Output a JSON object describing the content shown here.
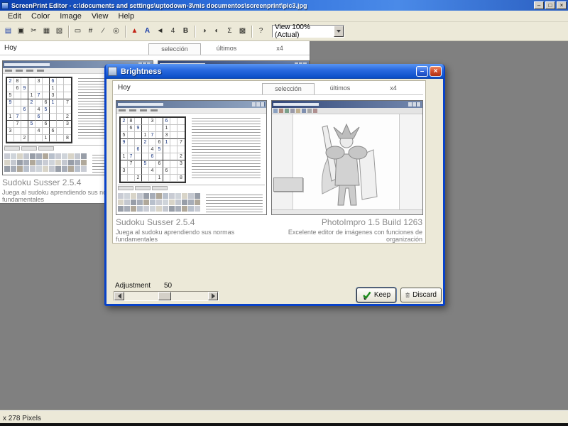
{
  "colors": {
    "titlebar_blue": "#2a6ad8",
    "desktop_gray": "#808080",
    "chrome_beige": "#ece9d8",
    "dialog_frame_blue": "#0842c8",
    "close_red": "#d4512e",
    "caption_gray": "#8a8a8a"
  },
  "window": {
    "title": "ScreenPrint Editor - c:\\documents and settings\\uptodown-3\\mis documentos\\screenprint\\pic3.jpg",
    "buttons": [
      {
        "name": "minimize",
        "glyph": "–"
      },
      {
        "name": "restore",
        "glyph": "□"
      },
      {
        "name": "close",
        "glyph": "×"
      }
    ],
    "menu": [
      "Edit",
      "Color",
      "Image",
      "View",
      "Help"
    ],
    "zoom_value": "View 100% (Actual)"
  },
  "toolbar": {
    "icons": [
      {
        "name": "save-icon",
        "glyph": "▤"
      },
      {
        "name": "capture-icon",
        "glyph": "▣"
      },
      {
        "name": "cut-icon",
        "glyph": "✂"
      },
      {
        "name": "copy-icon",
        "glyph": "▦"
      },
      {
        "name": "paste-icon",
        "glyph": "▧"
      },
      {
        "name": "select-icon",
        "glyph": "▭"
      },
      {
        "name": "crop-icon",
        "glyph": "#"
      },
      {
        "name": "pencil-icon",
        "glyph": "∕"
      },
      {
        "name": "zoom-icon",
        "glyph": "◎"
      },
      {
        "name": "warning-icon",
        "glyph": "▲"
      },
      {
        "name": "text-icon",
        "glyph": "A"
      },
      {
        "name": "mirror-icon",
        "glyph": "◄"
      },
      {
        "name": "rotate-icon",
        "glyph": "4"
      },
      {
        "name": "bold-icon",
        "glyph": "B"
      },
      {
        "name": "contrast-icon",
        "glyph": "◑"
      },
      {
        "name": "invert-icon",
        "glyph": "◐"
      },
      {
        "name": "sum-icon",
        "glyph": "Σ"
      },
      {
        "name": "gradient-icon",
        "glyph": "▩"
      },
      {
        "name": "help-icon",
        "glyph": "?"
      }
    ]
  },
  "page": {
    "header": "Hoy",
    "tabs": [
      "selección",
      "últimos",
      "x4"
    ],
    "left_app": {
      "title": "Sudoku Susser 2.5.4",
      "desc1": "Juega al sudoku aprendiendo sus normas",
      "desc2": "fundamentales"
    },
    "right_app": {
      "title": "PhotoImpro 1.5 Build 1263",
      "desc1": "Excelente editor de imágenes con funciones de",
      "desc2": "organización"
    },
    "sudoku_rows": [
      "28..3.6..",
      ".69...1..",
      "5..17.3..",
      "9..2.61.7",
      "..6.45...",
      "17..6...2",
      ".7.5.6..3",
      "3...4.6..",
      "..2..1..8"
    ]
  },
  "dialog": {
    "title": "Brightness",
    "buttons": [
      {
        "name": "minimize",
        "glyph": "–"
      },
      {
        "name": "close",
        "glyph": "×"
      }
    ],
    "adjustment": {
      "label": "Adjustment",
      "value": "50"
    },
    "keep_label": "Keep",
    "discard_label": "Discard"
  },
  "statusbar": {
    "text": "x 278 Pixels"
  }
}
